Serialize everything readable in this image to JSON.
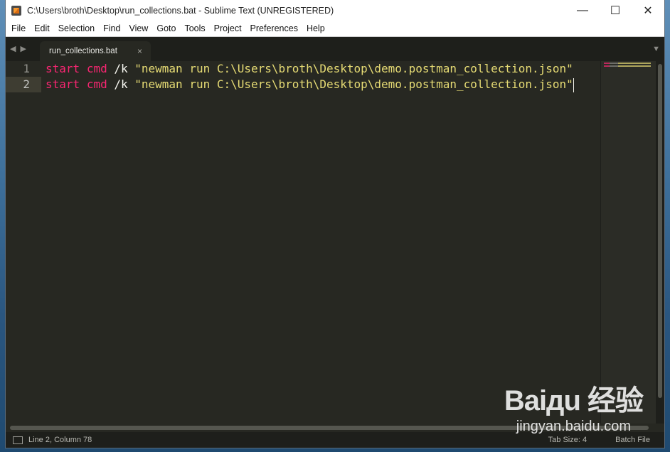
{
  "window": {
    "title": "C:\\Users\\broth\\Desktop\\run_collections.bat - Sublime Text (UNREGISTERED)",
    "controls": {
      "minimize": "—",
      "maximize": "☐",
      "close": "✕"
    }
  },
  "menu": {
    "items": [
      "File",
      "Edit",
      "Selection",
      "Find",
      "View",
      "Goto",
      "Tools",
      "Project",
      "Preferences",
      "Help"
    ]
  },
  "tabs": {
    "nav_back": "◀",
    "nav_forward": "▶",
    "active": {
      "label": "run_collections.bat",
      "close": "×"
    },
    "dropdown": "▼"
  },
  "editor": {
    "lines": [
      {
        "number": "1",
        "kw1": "start",
        "kw2": "cmd",
        "flag": " /k ",
        "string": "\"newman run C:\\Users\\broth\\Desktop\\demo.postman_collection.json\""
      },
      {
        "number": "2",
        "kw1": "start",
        "kw2": "cmd",
        "flag": " /k ",
        "string": "\"newman run C:\\Users\\broth\\Desktop\\demo.postman_collection.json\""
      }
    ],
    "active_line": 2
  },
  "status": {
    "position": "Line 2, Column 78",
    "tab_size": "Tab Size: 4",
    "syntax": "Batch File"
  },
  "watermark": {
    "logo": "Baiдu 经验",
    "site": "jingyan.baidu.com"
  },
  "colors": {
    "background": "#272822",
    "keyword": "#f92672",
    "string": "#e6db74",
    "text": "#f8f8f2",
    "gutter": "#90908a"
  }
}
